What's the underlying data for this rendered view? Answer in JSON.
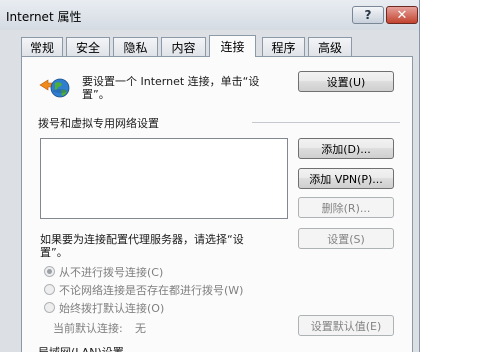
{
  "window": {
    "title": "Internet 属性",
    "help": "?",
    "close": "✕"
  },
  "tabs": [
    "常规",
    "安全",
    "隐私",
    "内容",
    "连接",
    "程序",
    "高级"
  ],
  "active_tab_index": 4,
  "setup": {
    "text_line1": "要设置一个 Internet 连接，单击“设",
    "text_line2": "置”。",
    "button": "设置(U)"
  },
  "dialup": {
    "group_label": "拨号和虚拟专用网络设置",
    "buttons": {
      "add": "添加(D)...",
      "add_vpn": "添加 VPN(P)...",
      "remove": "删除(R)..."
    }
  },
  "proxy": {
    "text_line1": "如果要为连接配置代理服务器，请选择“设",
    "text_line2": "置”。",
    "button": "设置(S)"
  },
  "radios": [
    {
      "label": "从不进行拨号连接(C)",
      "checked": true
    },
    {
      "label": "不论网络连接是否存在都进行拨号(W)",
      "checked": false
    },
    {
      "label": "始终拨打默认连接(O)",
      "checked": false
    }
  ],
  "current_default": {
    "label": "当前默认连接:",
    "value": "无"
  },
  "set_default_button": "设置默认值(E)",
  "lan_group_label": "局域网(LAN)设置"
}
